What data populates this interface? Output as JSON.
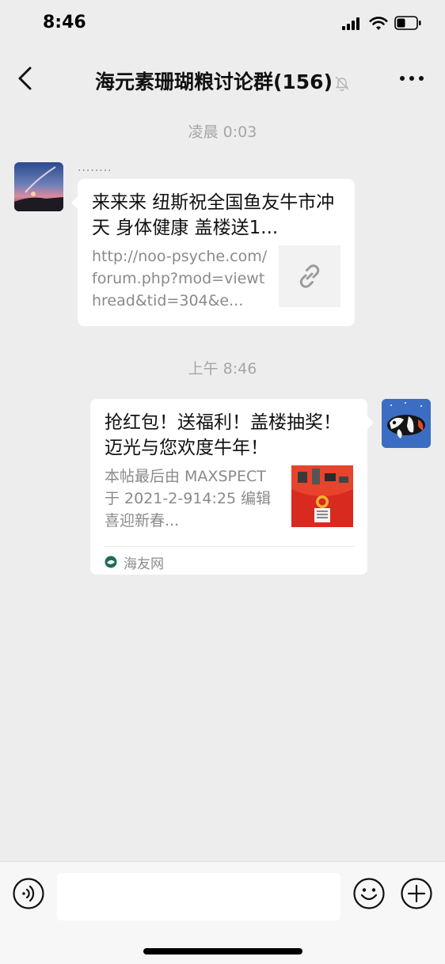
{
  "status_bar": {
    "time": "8:46"
  },
  "header": {
    "title": "海元素珊瑚粮讨论群(156)"
  },
  "messages": [
    {
      "timestamp": "凌晨 0:03",
      "sender_name": "........",
      "title": "来来来 纽斯祝全国鱼友牛市冲天 身体健康 盖楼送1...",
      "description": "http://noo-psyche.com/forum.php?mod=viewthread&tid=304&e...",
      "thumbnail_icon": "link-icon"
    },
    {
      "timestamp": "上午 8:46",
      "title": "抢红包！送福利！盖楼抽奖！迈光与您欢度牛年！",
      "description": "本帖最后由 MAXSPECT 于 2021-2-914:25 编辑喜迎新春...",
      "source": "海友网"
    }
  ],
  "colors": {
    "background": "#ededed",
    "bubble": "#ffffff",
    "timestamp_text": "#a6a6a6",
    "secondary_text": "#8a8a8a"
  }
}
